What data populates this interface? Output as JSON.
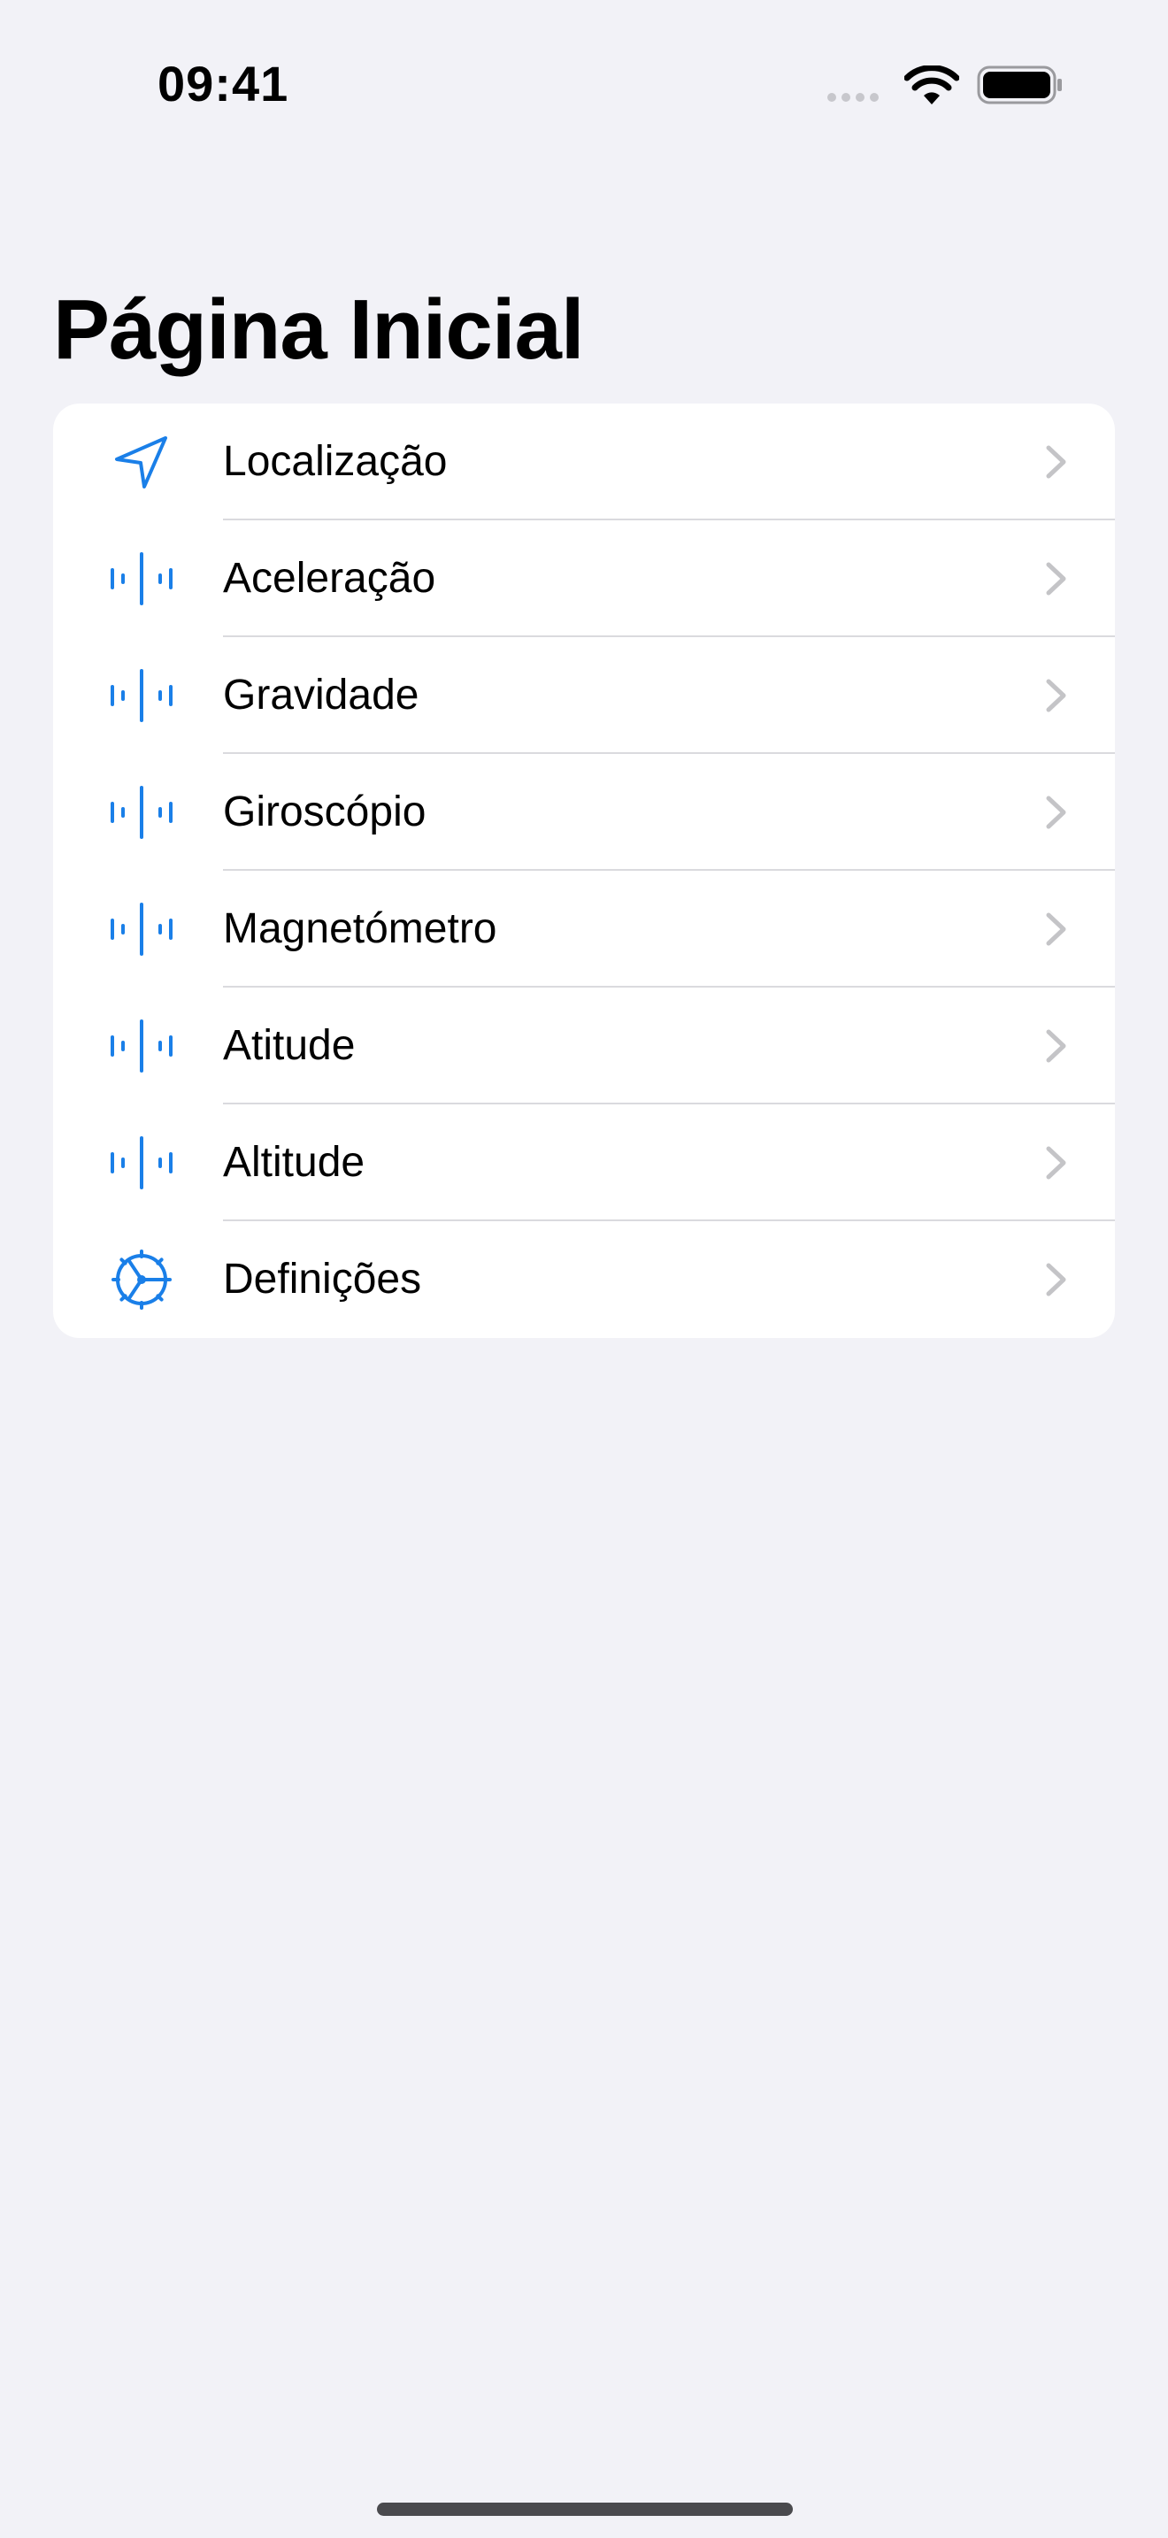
{
  "status_bar": {
    "time": "09:41"
  },
  "header": {
    "title": "Página Inicial"
  },
  "list": {
    "items": [
      {
        "label": "Localização",
        "icon": "location-arrow-icon"
      },
      {
        "label": "Aceleração",
        "icon": "waveform-icon"
      },
      {
        "label": "Gravidade",
        "icon": "waveform-icon"
      },
      {
        "label": "Giroscópio",
        "icon": "waveform-icon"
      },
      {
        "label": "Magnetómetro",
        "icon": "waveform-icon"
      },
      {
        "label": "Atitude",
        "icon": "waveform-icon"
      },
      {
        "label": "Altitude",
        "icon": "waveform-icon"
      },
      {
        "label": "Definições",
        "icon": "gear-icon"
      }
    ]
  },
  "colors": {
    "accent": "#1A7FE8",
    "background": "#F2F2F7",
    "card": "#FFFFFF",
    "separator": "#DADADE",
    "chevron": "#C4C4C7"
  }
}
